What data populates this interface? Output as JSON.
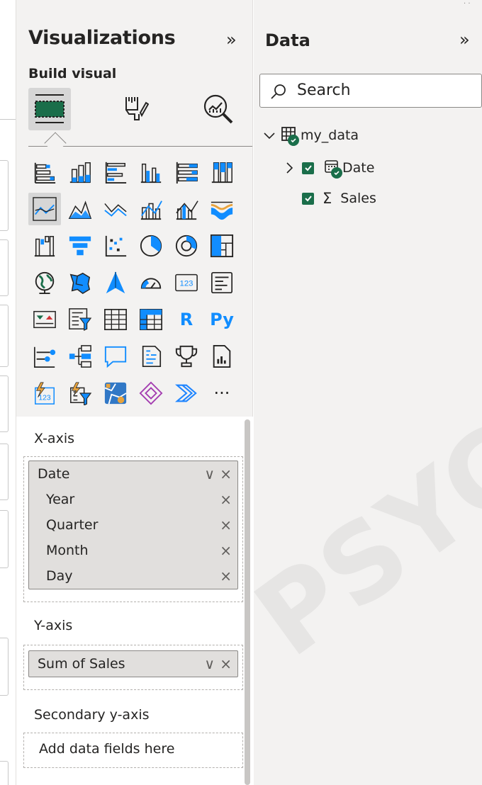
{
  "visualizations": {
    "title": "Visualizations",
    "collapse_glyph": "»",
    "build_label": "Build visual",
    "modes": [
      {
        "icon": "build-visual-icon",
        "selected": true
      },
      {
        "icon": "format-visual-icon",
        "selected": false
      },
      {
        "icon": "analytics-icon",
        "selected": false
      }
    ],
    "visual_types": [
      "stacked-bar-chart",
      "stacked-column-chart",
      "clustered-bar-chart",
      "clustered-column-chart",
      "100-percent-stacked-bar-chart",
      "100-percent-stacked-column-chart",
      "line-chart",
      "area-chart",
      "stacked-area-chart",
      "line-and-stacked-column-chart",
      "line-and-clustered-column-chart",
      "ribbon-chart",
      "waterfall-chart",
      "funnel-chart",
      "scatter-chart",
      "pie-chart",
      "donut-chart",
      "treemap",
      "map",
      "filled-map",
      "azure-map",
      "gauge",
      "card",
      "multi-row-card",
      "kpi",
      "slicer",
      "table",
      "matrix",
      "r-script-visual",
      "python-visual",
      "key-influencers",
      "decomposition-tree",
      "q-and-a",
      "smart-narrative",
      "metrics",
      "paginated-report",
      "power-automate",
      "power-apps",
      "arcgis-map",
      "power-apps-diamond",
      "power-automate-chevron",
      "more-visuals"
    ],
    "r_label": "R",
    "py_label": "Py",
    "more_label": "···",
    "xaxis": {
      "label": "X-axis",
      "field": "Date",
      "dropdown_glyph": "∨",
      "remove_glyph": "×",
      "hierarchy": [
        "Year",
        "Quarter",
        "Month",
        "Day"
      ]
    },
    "yaxis": {
      "label": "Y-axis",
      "field": "Sum of Sales"
    },
    "secondary_yaxis": {
      "label": "Secondary y-axis",
      "placeholder": "Add data fields here"
    }
  },
  "data": {
    "title": "Data",
    "collapse_glyph": "»",
    "search_placeholder": "Search",
    "table": {
      "name": "my_data",
      "fields": [
        {
          "name": "Date",
          "checked": true,
          "expandable": true,
          "icon": "calendar-table-icon"
        },
        {
          "name": "Sales",
          "checked": true,
          "expandable": false,
          "icon": "sigma-icon",
          "glyph": "Σ"
        }
      ]
    }
  },
  "watermark": "PSYCHO",
  "colors": {
    "accent": "#118dff",
    "check": "#1a6e4a",
    "pane": "#f3f2f1"
  }
}
